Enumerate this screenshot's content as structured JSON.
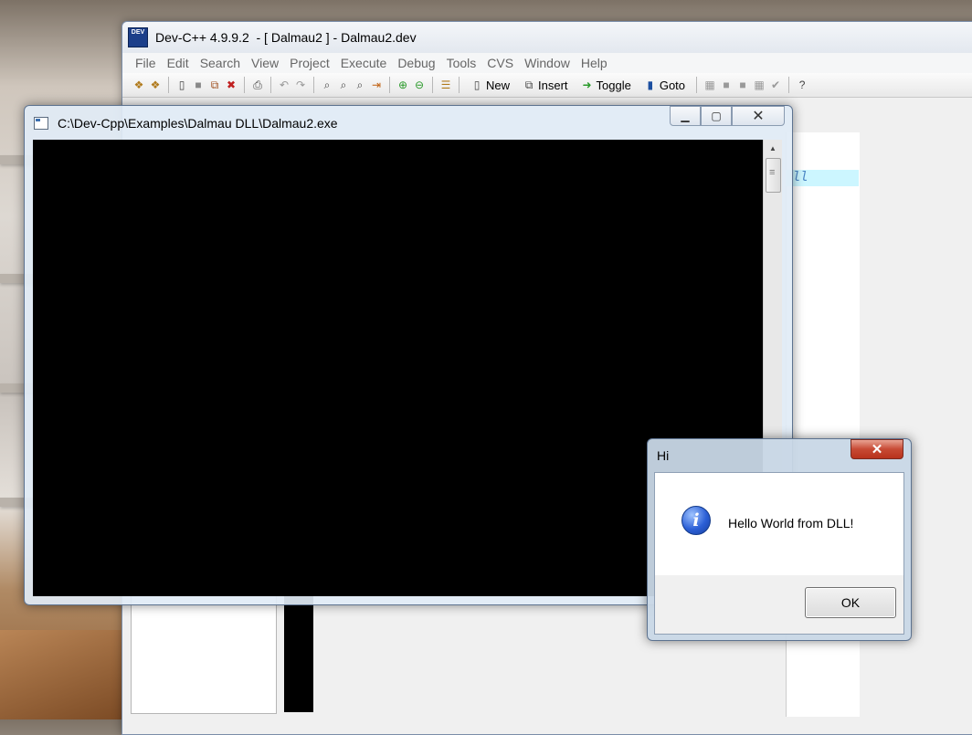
{
  "ide": {
    "title": "Dev-C++ 4.9.9.2  - [ Dalmau2 ] - Dalmau2.dev",
    "logo_text": "DEV",
    "menu": [
      "File",
      "Edit",
      "Search",
      "View",
      "Project",
      "Execute",
      "Debug",
      "Tools",
      "CVS",
      "Window",
      "Help"
    ],
    "toolbar": {
      "new_label": "New",
      "insert_label": "Insert",
      "toggle_label": "Toggle",
      "goto_label": "Goto"
    },
    "editor_fragment": "ll"
  },
  "console": {
    "title": "C:\\Dev-Cpp\\Examples\\Dalmau DLL\\Dalmau2.exe",
    "minimize_glyph": "▁",
    "maximize_glyph": "▢",
    "close_glyph": "✕"
  },
  "msgbox": {
    "title": "Hi",
    "close_glyph": "✕",
    "icon_glyph": "i",
    "message": "Hello World from DLL!",
    "ok_label": "OK"
  }
}
